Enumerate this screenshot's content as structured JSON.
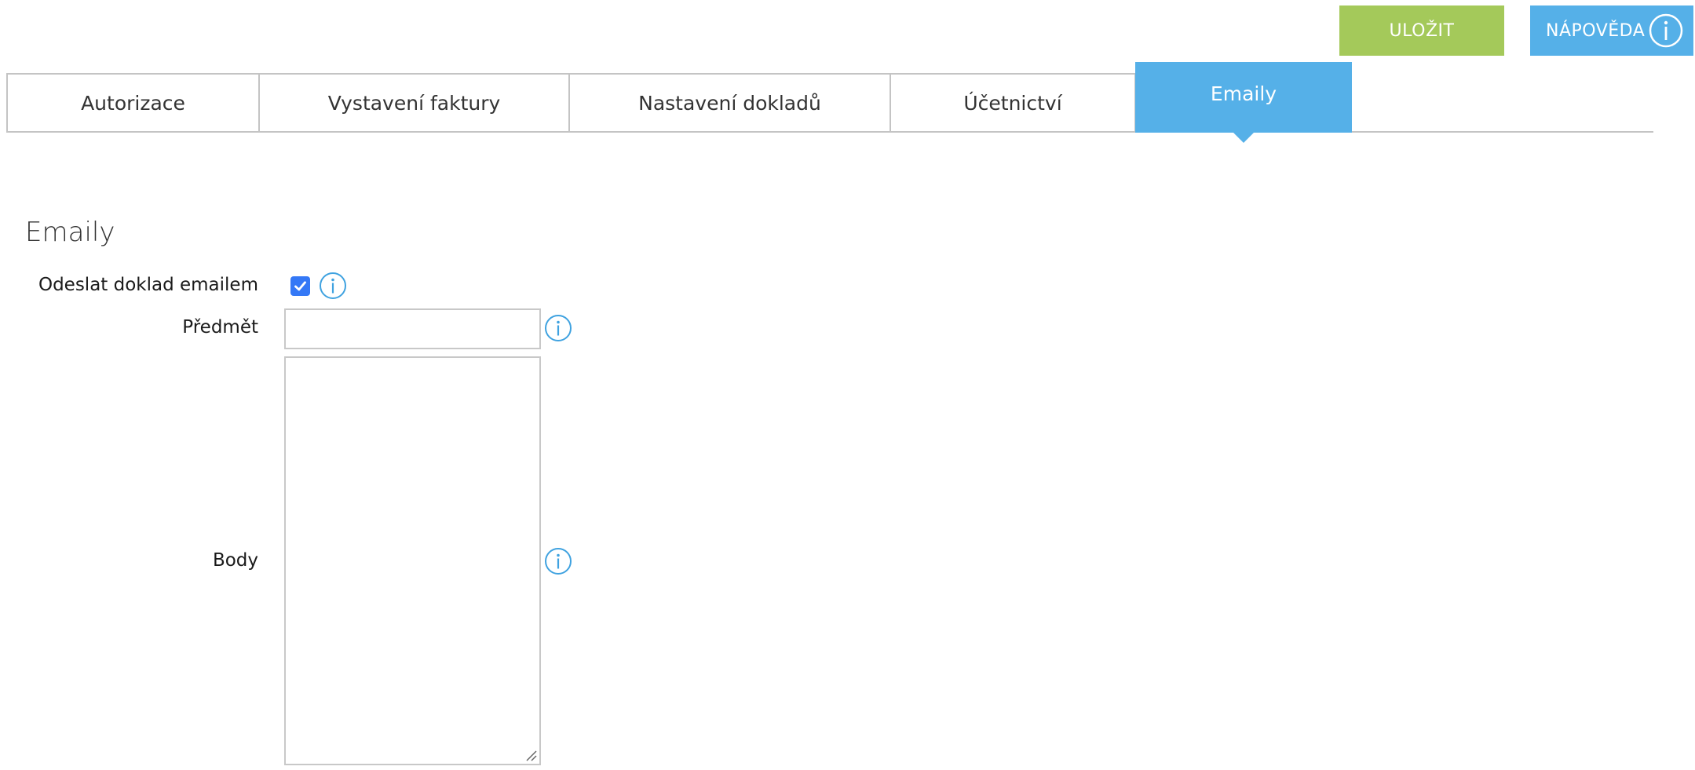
{
  "header": {
    "save_label": "ULOŽIT",
    "help_label": "NÁPOVĚDA"
  },
  "tabs": [
    {
      "label": "Autorizace",
      "active": false
    },
    {
      "label": "Vystavení faktury",
      "active": false
    },
    {
      "label": "Nastavení dokladů",
      "active": false
    },
    {
      "label": "Účetnictví",
      "active": false
    },
    {
      "label": "Emaily",
      "active": true
    }
  ],
  "section": {
    "title": "Emaily"
  },
  "form": {
    "send_label": "Odeslat doklad emailem",
    "send_checked": true,
    "subject_label": "Předmět",
    "subject_value": "",
    "body_label": "Body",
    "body_value": ""
  },
  "colors": {
    "save_button": "#a4c95a",
    "accent_blue": "#55b0e8",
    "checkbox_blue": "#3478f6",
    "border_gray": "#c4c4c4"
  },
  "icons": {
    "help": "info-icon",
    "field_info": "info-icon",
    "checkbox": "checkmark-icon",
    "resize": "resize-grip-icon"
  }
}
